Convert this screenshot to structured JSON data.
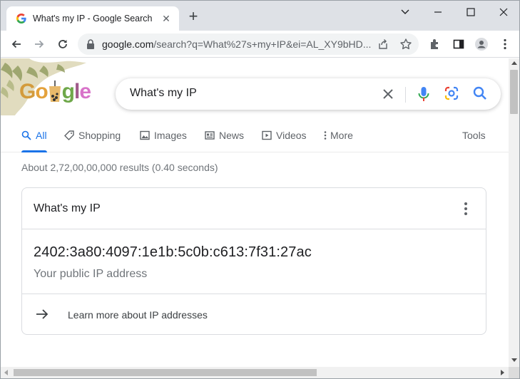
{
  "browser": {
    "tab_title": "What's my IP - Google Search",
    "new_tab_label": "+",
    "url_host": "google.com",
    "url_path": "/search?q=What%27s+my+IP&ei=AL_XY9bHD..."
  },
  "search": {
    "logo_letters": [
      "G",
      "o",
      "o",
      "g",
      "l",
      "e"
    ],
    "query": "What's my IP"
  },
  "tabs": [
    {
      "label": "All",
      "icon": "search-icon"
    },
    {
      "label": "Shopping",
      "icon": "tag-icon"
    },
    {
      "label": "Images",
      "icon": "image-icon"
    },
    {
      "label": "News",
      "icon": "news-icon"
    },
    {
      "label": "Videos",
      "icon": "video-icon"
    },
    {
      "label": "More",
      "icon": "more-vert-icon"
    }
  ],
  "tools_label": "Tools",
  "results_stats": "About 2,72,00,00,000 results (0.40 seconds)",
  "ip_card": {
    "title": "What's my IP",
    "ip_address": "2402:3a80:4097:1e1b:5c0b:c613:7f31:27ac",
    "subtitle": "Your public IP address",
    "learn_more": "Learn more about IP addresses"
  },
  "colors": {
    "accent": "#1a73e8",
    "tabstrip": "#dee1e6",
    "omnibox": "#f1f3f4"
  }
}
